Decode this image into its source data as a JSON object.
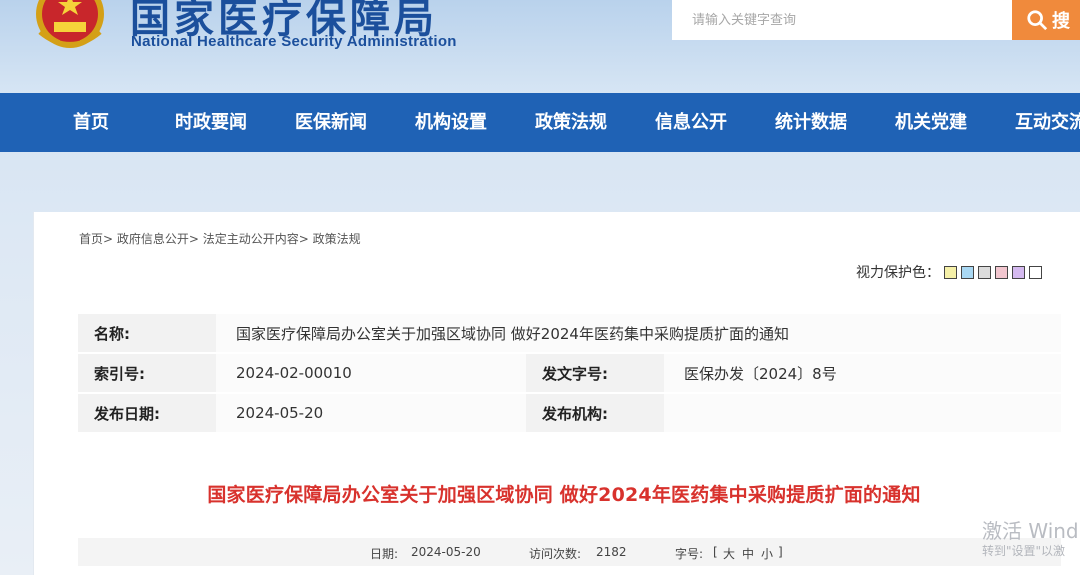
{
  "header": {
    "title": "国家医疗保障局",
    "subtitle": "National Healthcare Security Administration",
    "search_placeholder": "请输入关键字查询",
    "search_button": "搜"
  },
  "nav": {
    "items": [
      "首页",
      "时政要闻",
      "医保新闻",
      "机构设置",
      "政策法规",
      "信息公开",
      "统计数据",
      "机关党建",
      "互动交流"
    ]
  },
  "breadcrumb": [
    "首页>",
    "政府信息公开>",
    "法定主动公开内容>",
    "政策法规"
  ],
  "eye_care": {
    "label": "视力保护色：",
    "colors": [
      "#f5f0a8",
      "#a9d8f3",
      "#dcdcdc",
      "#f2c6cf",
      "#d4b9ef",
      "#ffffff"
    ]
  },
  "meta": {
    "name_label": "名称:",
    "name_value": "国家医疗保障局办公室关于加强区域协同 做好2024年医药集中采购提质扩面的通知",
    "index_label": "索引号:",
    "index_value": "2024-02-00010",
    "docno_label": "发文字号:",
    "docno_value": "医保办发〔2024〕8号",
    "date_label": "发布日期:",
    "date_value": "2024-05-20",
    "org_label": "发布机构:",
    "org_value": ""
  },
  "document": {
    "title": "国家医疗保障局办公室关于加强区域协同 做好2024年医药集中采购提质扩面的通知"
  },
  "info_bar": {
    "date_label": "日期:",
    "date_value": "2024-05-20",
    "visits_label": "访问次数:",
    "visits_value": "2182",
    "font_label": "字号:",
    "font_open": "[",
    "font_large": "大",
    "font_medium": "中",
    "font_small": "小",
    "font_close": "]"
  },
  "watermark": {
    "line1": "激活 Wind",
    "line2": "转到\"设置\"以激"
  }
}
